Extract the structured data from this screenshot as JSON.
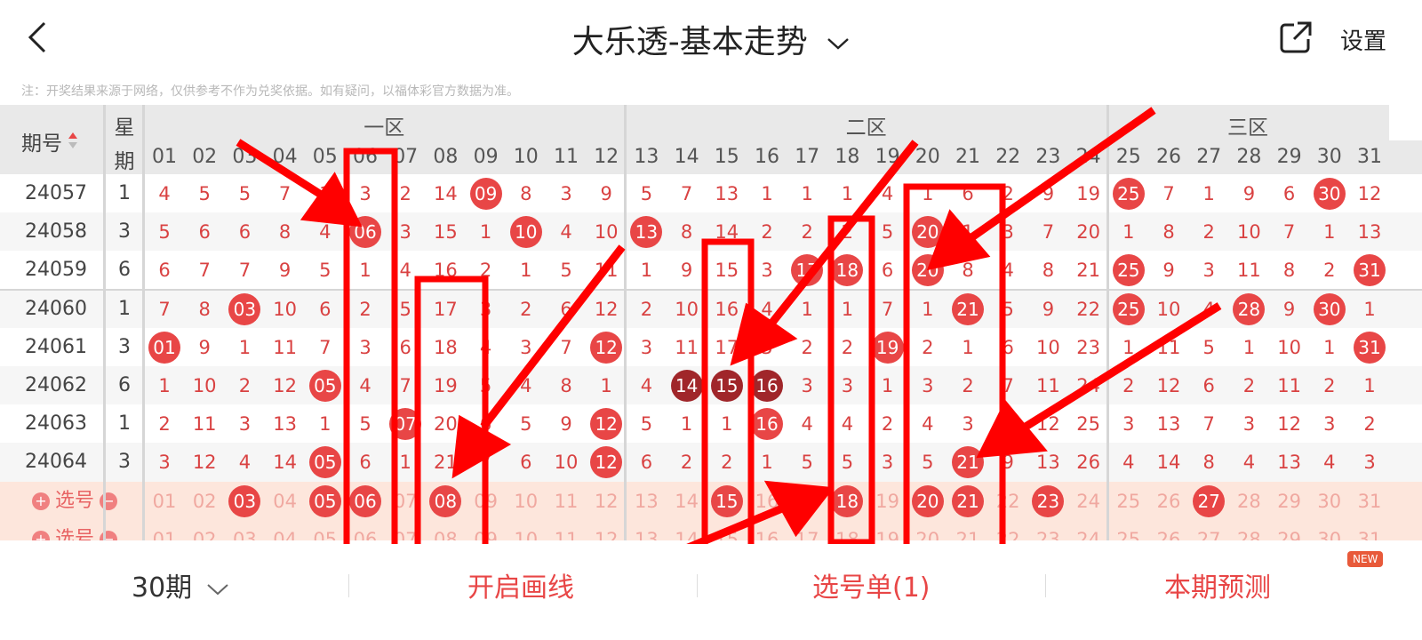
{
  "header": {
    "title": "大乐透-基本走势",
    "settings_label": "设置"
  },
  "note": "注：开奖结果来源于网络，仅供参考不作为兑奖依据。如有疑问，以福体彩官方数据为准。",
  "table": {
    "period_header": "期号",
    "week_header_1": "星",
    "week_header_2": "期",
    "zones": [
      "一区",
      "二区",
      "三区"
    ],
    "columns": [
      "01",
      "02",
      "03",
      "04",
      "05",
      "06",
      "07",
      "08",
      "09",
      "10",
      "11",
      "12",
      "13",
      "14",
      "15",
      "16",
      "17",
      "18",
      "19",
      "20",
      "21",
      "22",
      "23",
      "24",
      "25",
      "26",
      "27",
      "28",
      "29",
      "30",
      "31"
    ],
    "rows": [
      {
        "period": "24057",
        "week": "1",
        "cells": [
          "4",
          "5",
          "5",
          "7",
          "1",
          "3",
          "2",
          "14",
          "09",
          "8",
          "3",
          "9",
          "5",
          "7",
          "13",
          "1",
          "1",
          "1",
          "4",
          "1",
          "6",
          "2",
          "9",
          "19",
          "25",
          "7",
          "1",
          "9",
          "6",
          "30",
          "12"
        ],
        "balls": [
          8,
          24,
          29
        ]
      },
      {
        "period": "24058",
        "week": "3",
        "cells": [
          "5",
          "6",
          "6",
          "8",
          "4",
          "06",
          "3",
          "15",
          "1",
          "10",
          "4",
          "10",
          "13",
          "8",
          "14",
          "2",
          "2",
          "2",
          "5",
          "20",
          "1",
          "3",
          "7",
          "20",
          "1",
          "8",
          "2",
          "10",
          "7",
          "1",
          "13"
        ],
        "balls": [
          5,
          9,
          12,
          19
        ]
      },
      {
        "period": "24059",
        "week": "6",
        "cells": [
          "6",
          "7",
          "7",
          "9",
          "5",
          "1",
          "4",
          "16",
          "2",
          "1",
          "5",
          "11",
          "1",
          "9",
          "15",
          "3",
          "17",
          "18",
          "6",
          "20",
          "8",
          "4",
          "8",
          "21",
          "25",
          "9",
          "3",
          "11",
          "8",
          "2",
          "31"
        ],
        "balls": [
          16,
          17,
          19,
          24,
          30
        ]
      },
      {
        "period": "24060",
        "week": "1",
        "cells": [
          "7",
          "8",
          "03",
          "10",
          "6",
          "2",
          "5",
          "17",
          "3",
          "2",
          "6",
          "12",
          "2",
          "10",
          "16",
          "4",
          "1",
          "1",
          "7",
          "1",
          "21",
          "5",
          "9",
          "22",
          "25",
          "10",
          "4",
          "28",
          "9",
          "30",
          "1"
        ],
        "balls": [
          2,
          20,
          24,
          27,
          29
        ]
      },
      {
        "period": "24061",
        "week": "3",
        "cells": [
          "01",
          "9",
          "1",
          "11",
          "7",
          "3",
          "6",
          "18",
          "4",
          "3",
          "7",
          "12",
          "3",
          "11",
          "17",
          "5",
          "2",
          "2",
          "19",
          "2",
          "1",
          "6",
          "10",
          "23",
          "1",
          "11",
          "5",
          "1",
          "10",
          "1",
          "31"
        ],
        "balls": [
          0,
          11,
          18,
          30
        ]
      },
      {
        "period": "24062",
        "week": "6",
        "cells": [
          "1",
          "10",
          "2",
          "12",
          "05",
          "4",
          "7",
          "19",
          "5",
          "4",
          "8",
          "1",
          "4",
          "14",
          "15",
          "16",
          "3",
          "3",
          "1",
          "3",
          "2",
          "7",
          "11",
          "24",
          "2",
          "12",
          "6",
          "2",
          "11",
          "2",
          "1"
        ],
        "balls": [
          4
        ],
        "dark": [
          13,
          14,
          15
        ]
      },
      {
        "period": "24063",
        "week": "1",
        "cells": [
          "2",
          "11",
          "3",
          "13",
          "1",
          "5",
          "07",
          "20",
          "6",
          "5",
          "9",
          "12",
          "5",
          "1",
          "1",
          "16",
          "4",
          "4",
          "2",
          "4",
          "3",
          "8",
          "12",
          "25",
          "3",
          "13",
          "7",
          "3",
          "12",
          "3",
          "2"
        ],
        "balls": [
          6,
          11,
          15
        ]
      },
      {
        "period": "24064",
        "week": "3",
        "cells": [
          "3",
          "12",
          "4",
          "14",
          "05",
          "6",
          "1",
          "21",
          "7",
          "6",
          "10",
          "12",
          "6",
          "2",
          "2",
          "1",
          "5",
          "5",
          "3",
          "5",
          "21",
          "9",
          "13",
          "26",
          "4",
          "14",
          "8",
          "4",
          "13",
          "4",
          "3"
        ],
        "balls": [
          4,
          11,
          20
        ]
      }
    ],
    "select_label": "选号",
    "select_rows": [
      {
        "balls": [
          2,
          4,
          5,
          7,
          14,
          17,
          19,
          20,
          22,
          26
        ]
      },
      {
        "balls": []
      }
    ]
  },
  "footer": {
    "periods": "30期",
    "draw_lines": "开启画线",
    "selection_list": "选号单(1)",
    "prediction": "本期预测",
    "new_badge": "NEW"
  },
  "colors": {
    "accent": "#e84646",
    "annotation": "#ff0000"
  }
}
